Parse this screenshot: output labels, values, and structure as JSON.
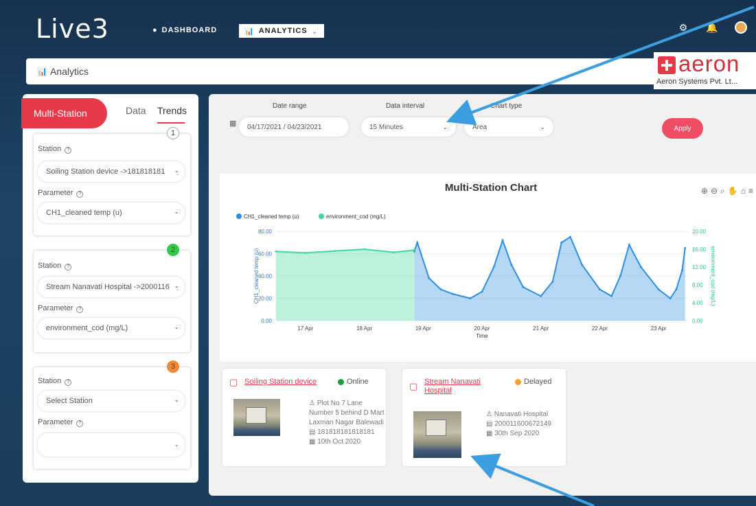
{
  "header": {
    "logo": "Live3",
    "nav": [
      {
        "label": "DASHBOARD"
      },
      {
        "label": "ANALYTICS"
      }
    ]
  },
  "breadcrumb": {
    "title": "Analytics"
  },
  "brand": {
    "name": "aeron",
    "subtitle": "Aeron Systems Pvt. Lt..."
  },
  "left_panel": {
    "tabs": {
      "multi": "Multi-Station",
      "data": "Data",
      "trends": "Trends"
    },
    "stations": [
      {
        "badge": "1",
        "station_label": "Station",
        "station_value": "Soiling Station device ->181818181",
        "parameter_label": "Parameter",
        "parameter_value": "CH1_cleaned temp (u)"
      },
      {
        "badge": "2",
        "station_label": "Station",
        "station_value": "Stream Nanavati Hospital ->2000116",
        "parameter_label": "Parameter",
        "parameter_value": "environment_cod (mg/L)"
      },
      {
        "badge": "3",
        "station_label": "Station",
        "station_value": "Select Station",
        "parameter_label": "Parameter",
        "parameter_value": ""
      }
    ]
  },
  "filters": {
    "date_range_label": "Date range",
    "date_range_value": "04/17/2021 / 04/23/2021",
    "interval_label": "Data interval",
    "interval_value": "15 Minutes",
    "chart_type_label": "Chart type",
    "chart_type_value": "Area",
    "apply_label": "Apply"
  },
  "chart_data": {
    "type": "area",
    "title": "Multi-Station Chart",
    "xlabel": "Time",
    "ylabel": "CH1_cleaned temp (u)",
    "y2label": "environment_cod (mg/L)",
    "x_ticks": [
      "17 Apr",
      "18 Apr",
      "19 Apr",
      "20 Apr",
      "21 Apr",
      "22 Apr",
      "23 Apr"
    ],
    "y_ticks": [
      "0.00",
      "20.00",
      "40.00",
      "60.00",
      "80.00"
    ],
    "y2_ticks": [
      "0.00",
      "4.00",
      "8.00",
      "12.00",
      "16.00",
      "20.00"
    ],
    "ylim": [
      0,
      80
    ],
    "y2lim": [
      0,
      20
    ],
    "legend_position": "top-left",
    "series": [
      {
        "name": "CH1_cleaned temp (u)",
        "color": "#2f8ee0",
        "axis": "left",
        "x": [
          2.35,
          2.4,
          2.6,
          2.8,
          3.0,
          3.3,
          3.5,
          3.7,
          3.85,
          4.0,
          4.2,
          4.5,
          4.7,
          4.85,
          5.0,
          5.2,
          5.5,
          5.7,
          5.85,
          6.0,
          6.2,
          6.5,
          6.7,
          6.8,
          6.9,
          6.95
        ],
        "values": [
          62,
          70,
          38,
          28,
          24,
          20,
          26,
          48,
          72,
          50,
          30,
          22,
          35,
          70,
          75,
          50,
          28,
          22,
          40,
          68,
          48,
          28,
          20,
          28,
          45,
          65
        ]
      },
      {
        "name": "environment_cod (mg/L)",
        "color": "#3fd89a",
        "axis": "right",
        "x": [
          0,
          0.5,
          1.0,
          1.5,
          2.0,
          2.35
        ],
        "values": [
          15.5,
          15.2,
          15.6,
          16.0,
          15.3,
          15.8
        ]
      }
    ]
  },
  "devices": [
    {
      "name": "Soiling Station device",
      "status": "Online",
      "status_color": "#1e9e3a",
      "address": "Plot No 7 Lane Number 5 behind D Mart Laxman Nagar Balewadi",
      "id": "181818181818181",
      "date": "10th Oct 2020"
    },
    {
      "name": "Stream Nanavati Hospital",
      "status": "Delayed",
      "status_color": "#f0a030",
      "address": "Nanavati Hospital",
      "id": "200011600672149",
      "date": "30th Sep 2020"
    }
  ]
}
